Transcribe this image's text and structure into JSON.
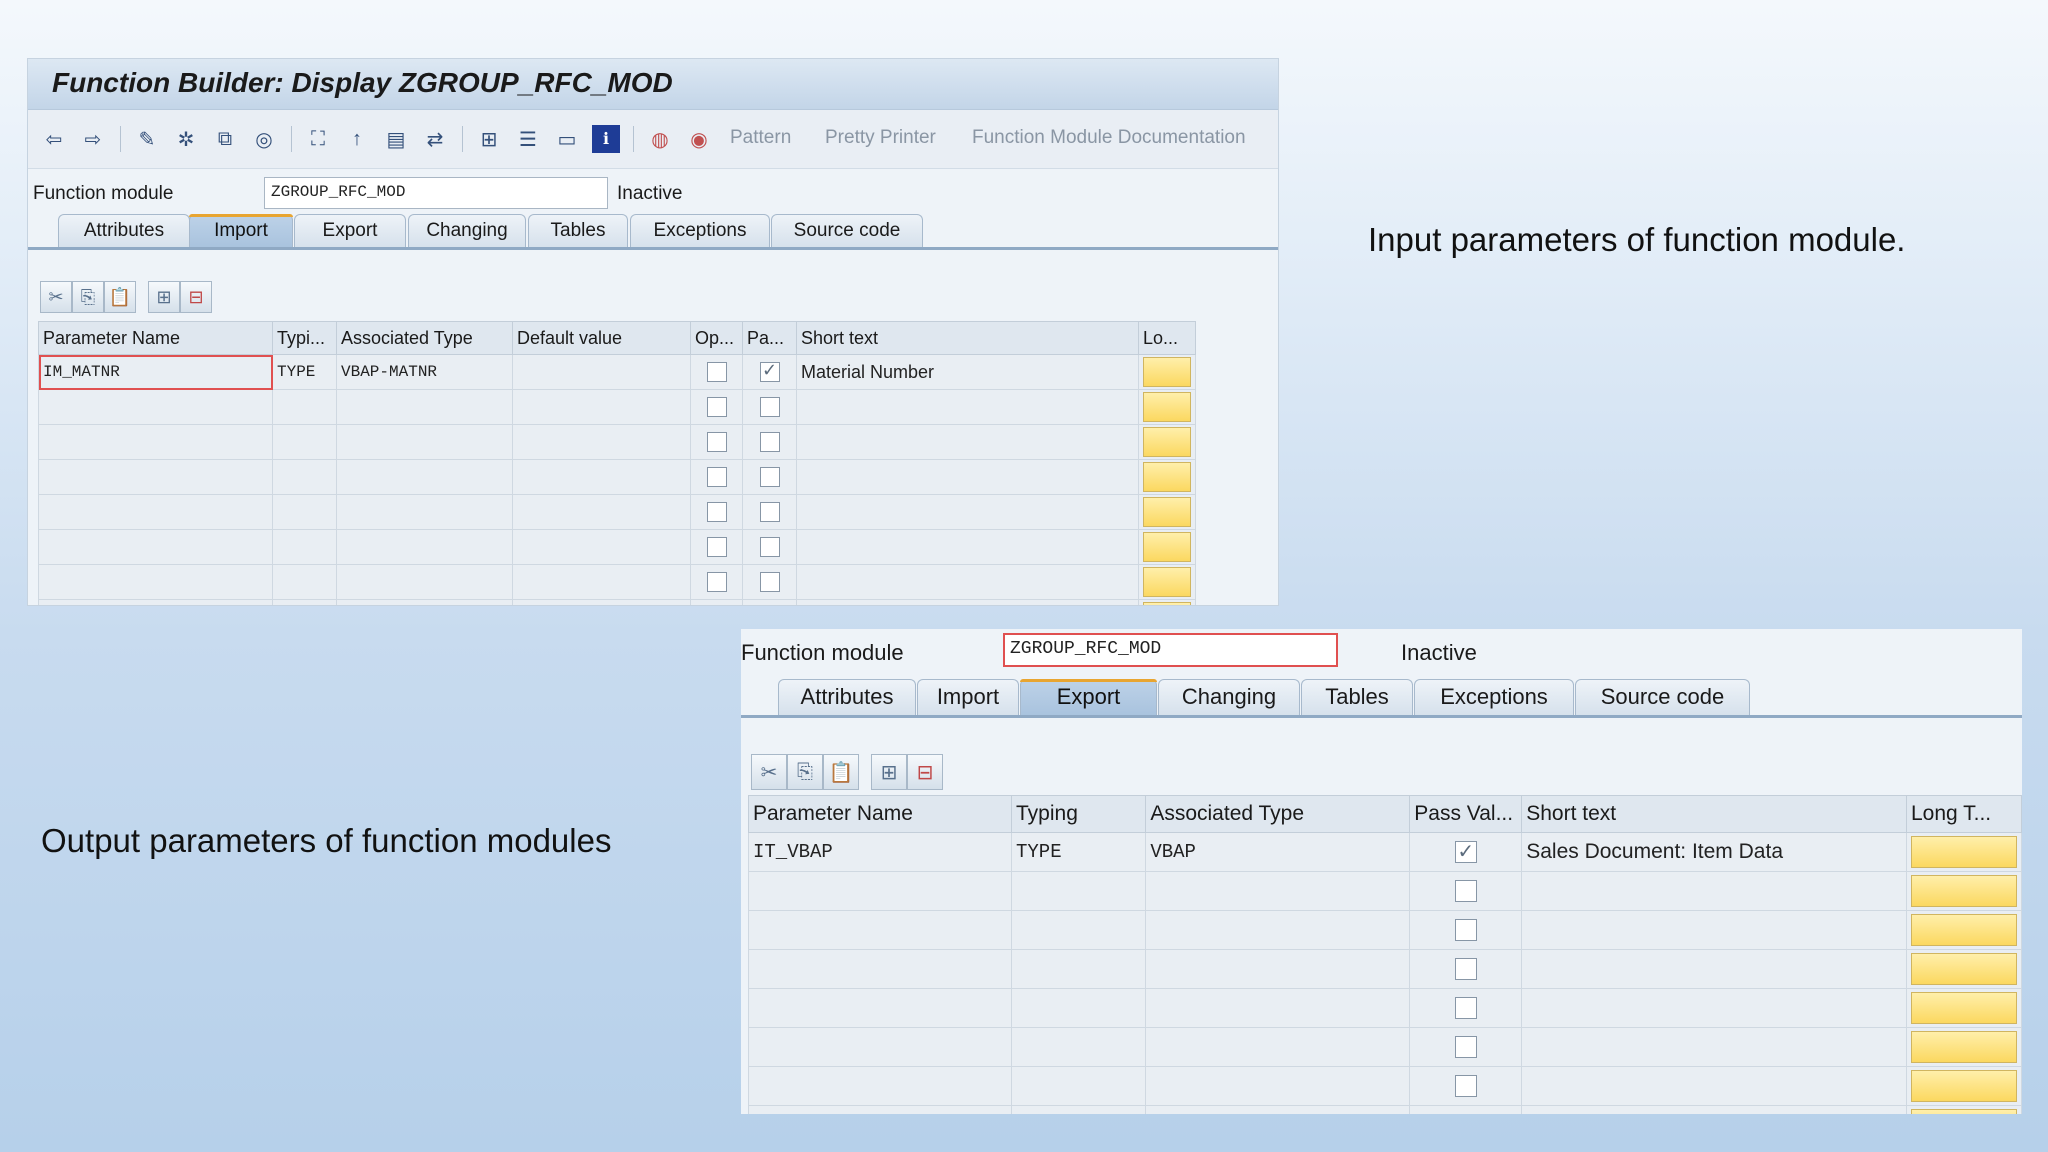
{
  "colors": {
    "accent": "#e8a531",
    "long_text_button": "#fbd860",
    "background": "#c8dbef"
  },
  "panel1": {
    "title": "Function Builder: Display ZGROUP_RFC_MOD",
    "toolbar": {
      "icons": [
        "back-icon",
        "forward-icon",
        "check-icon",
        "activate-icon",
        "test-icon",
        "where-used-icon",
        "object-list-icon",
        "navigation-icon",
        "display-object-icon",
        "inactive-icon",
        "hierarchy-icon",
        "print-icon",
        "table-icon",
        "info-icon",
        "breakpoint-icon",
        "session-breakpoint-icon"
      ],
      "pattern": "Pattern",
      "pretty_printer": "Pretty Printer",
      "documentation": "Function Module Documentation"
    },
    "fm_label": "Function module",
    "fm_value": "ZGROUP_RFC_MOD",
    "status": "Inactive",
    "tabs": [
      "Attributes",
      "Import",
      "Export",
      "Changing",
      "Tables",
      "Exceptions",
      "Source code"
    ],
    "active_tab": "Import",
    "columns": [
      "Parameter Name",
      "Typi...",
      "Associated Type",
      "Default value",
      "Op...",
      "Pa...",
      "Short text",
      "Lo..."
    ],
    "rows": [
      {
        "name": "IM_MATNR",
        "typing": "TYPE",
        "assoc": "VBAP-MATNR",
        "default": "",
        "optional": false,
        "pass_value": true,
        "short_text": "Material Number"
      }
    ],
    "empty_rows": 7
  },
  "panel2": {
    "fm_label": "Function module",
    "fm_value": "ZGROUP_RFC_MOD",
    "status": "Inactive",
    "tabs": [
      "Attributes",
      "Import",
      "Export",
      "Changing",
      "Tables",
      "Exceptions",
      "Source code"
    ],
    "active_tab": "Export",
    "columns": [
      "Parameter Name",
      "Typing",
      "Associated Type",
      "Pass Val...",
      "Short text",
      "Long T..."
    ],
    "rows": [
      {
        "name": "IT_VBAP",
        "typing": "TYPE",
        "assoc": "VBAP",
        "pass_value": true,
        "short_text": "Sales Document: Item Data"
      }
    ],
    "empty_rows": 7
  },
  "notes": {
    "input": "Input parameters of function module.",
    "output": "Output parameters of function modules"
  }
}
